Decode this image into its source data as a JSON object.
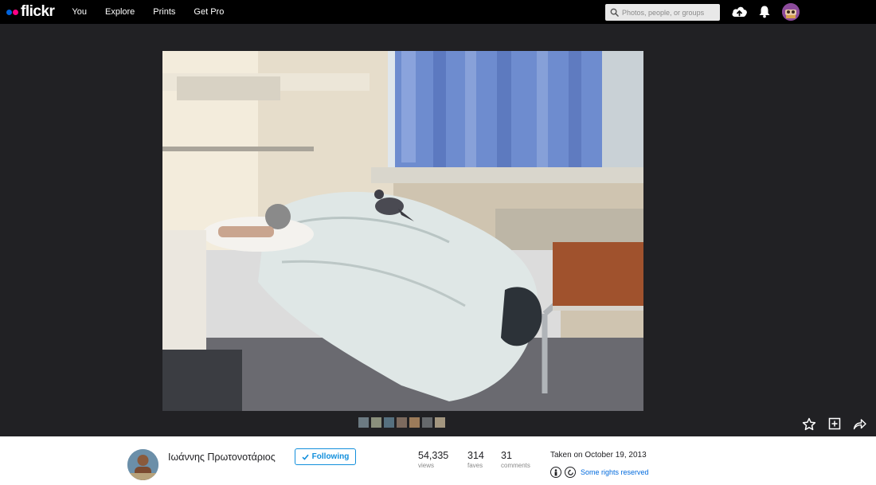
{
  "header": {
    "logo_text": "flickr",
    "nav": [
      "You",
      "Explore",
      "Prints",
      "Get Pro"
    ],
    "search_placeholder": "Photos, people, or groups"
  },
  "photo": {
    "thumb_colors": [
      "#6c7a82",
      "#8a8f7c",
      "#56707f",
      "#7c6a5e",
      "#9c7b5a",
      "#66696c",
      "#a3967f"
    ]
  },
  "footer": {
    "owner_name": "Ιωάννης Πρωτονοτάριος",
    "follow_label": "Following",
    "stats": [
      {
        "value": "54,335",
        "label": "views"
      },
      {
        "value": "314",
        "label": "faves"
      },
      {
        "value": "31",
        "label": "comments"
      }
    ],
    "taken": "Taken on October 19, 2013",
    "license_text": "Some rights reserved"
  },
  "colors": {
    "accent": "#128fdc",
    "link": "#006add",
    "background": "#212124"
  }
}
